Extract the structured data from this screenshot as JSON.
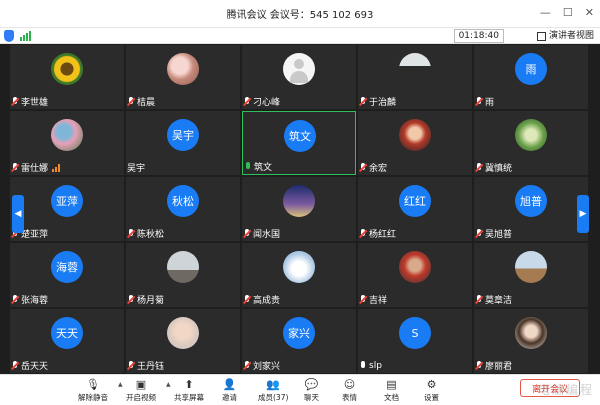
{
  "window": {
    "title": "腾讯会议  会议号：545 102 693",
    "controls": [
      "—",
      "☐",
      "✕"
    ]
  },
  "status": {
    "timer": "01:18:40",
    "speaker_view_label": "演讲者视图"
  },
  "participants": [
    {
      "name": "李世雄",
      "avatar": "photo-sunflower",
      "avatar_text": "",
      "mic": "muted",
      "bars": false,
      "active": false
    },
    {
      "name": "桔晨",
      "avatar": "photo-toy",
      "avatar_text": "",
      "mic": "muted",
      "bars": false,
      "active": false
    },
    {
      "name": "刁心峰",
      "avatar": "photo-default",
      "avatar_text": "",
      "mic": "muted",
      "bars": false,
      "active": false
    },
    {
      "name": "于治麟",
      "avatar": "photo-man",
      "avatar_text": "",
      "mic": "muted",
      "bars": false,
      "active": false
    },
    {
      "name": "雨",
      "avatar": "text",
      "avatar_text": "雨",
      "mic": "muted",
      "bars": false,
      "active": false
    },
    {
      "name": "雷仕娜",
      "avatar": "photo-flowers",
      "avatar_text": "",
      "mic": "muted",
      "bars": true,
      "active": false
    },
    {
      "name": "吴宇",
      "avatar": "text",
      "avatar_text": "吴宇",
      "mic": "none",
      "bars": false,
      "active": false
    },
    {
      "name": "筑文",
      "avatar": "text",
      "avatar_text": "筑文",
      "mic": "green",
      "bars": false,
      "active": true
    },
    {
      "name": "余宏",
      "avatar": "photo-child",
      "avatar_text": "",
      "mic": "muted",
      "bars": false,
      "active": false
    },
    {
      "name": "冀慎统",
      "avatar": "photo-green",
      "avatar_text": "",
      "mic": "muted",
      "bars": false,
      "active": false
    },
    {
      "name": "楚亚萍",
      "avatar": "text",
      "avatar_text": "亚萍",
      "mic": "muted",
      "bars": false,
      "active": false
    },
    {
      "name": "陈秋松",
      "avatar": "text",
      "avatar_text": "秋松",
      "mic": "muted",
      "bars": false,
      "active": false
    },
    {
      "name": "闻水国",
      "avatar": "photo-night",
      "avatar_text": "",
      "mic": "muted",
      "bars": false,
      "active": false
    },
    {
      "name": "杨红红",
      "avatar": "text",
      "avatar_text": "红红",
      "mic": "muted",
      "bars": false,
      "active": false
    },
    {
      "name": "吴旭普",
      "avatar": "text",
      "avatar_text": "旭普",
      "mic": "muted",
      "bars": false,
      "active": false
    },
    {
      "name": "张海蓉",
      "avatar": "text",
      "avatar_text": "海蓉",
      "mic": "muted",
      "bars": false,
      "active": false
    },
    {
      "name": "杨月菊",
      "avatar": "photo-church",
      "avatar_text": "",
      "mic": "muted",
      "bars": false,
      "active": false
    },
    {
      "name": "高成贵",
      "avatar": "photo-cloud",
      "avatar_text": "",
      "mic": "muted",
      "bars": false,
      "active": false
    },
    {
      "name": "吉祥",
      "avatar": "photo-boy",
      "avatar_text": "",
      "mic": "muted",
      "bars": false,
      "active": false
    },
    {
      "name": "莫章洁",
      "avatar": "photo-bridge",
      "avatar_text": "",
      "mic": "muted",
      "bars": false,
      "active": false
    },
    {
      "name": "岳天天",
      "avatar": "text",
      "avatar_text": "天天",
      "mic": "muted",
      "bars": false,
      "active": false
    },
    {
      "name": "王丹钰",
      "avatar": "photo-baby",
      "avatar_text": "",
      "mic": "muted",
      "bars": false,
      "active": false
    },
    {
      "name": "刘家兴",
      "avatar": "text",
      "avatar_text": "家兴",
      "mic": "muted",
      "bars": false,
      "active": false
    },
    {
      "name": "slp",
      "avatar": "text",
      "avatar_text": "S",
      "mic": "plain",
      "bars": false,
      "active": false
    },
    {
      "name": "廖丽君",
      "avatar": "photo-girl",
      "avatar_text": "",
      "mic": "muted",
      "bars": false,
      "active": false
    }
  ],
  "nav": {
    "prev": "◀",
    "next": "▶"
  },
  "toolbar": {
    "items": [
      {
        "label": "解除静音",
        "icon": "microphone-muted-icon",
        "glyph": "🎙"
      },
      {
        "label": "开启视频",
        "icon": "camera-off-icon",
        "glyph": "▣"
      },
      {
        "label": "共享屏幕",
        "icon": "share-screen-icon",
        "glyph": "⬆"
      },
      {
        "label": "邀请",
        "icon": "invite-icon",
        "glyph": "👤"
      },
      {
        "label": "成员(37)",
        "icon": "members-icon",
        "glyph": "👥"
      },
      {
        "label": "聊天",
        "icon": "chat-icon",
        "glyph": "💬"
      },
      {
        "label": "表情",
        "icon": "emoji-icon",
        "glyph": "☺"
      },
      {
        "label": "文档",
        "icon": "document-icon",
        "glyph": "▤"
      },
      {
        "label": "设置",
        "icon": "settings-icon",
        "glyph": "⚙"
      }
    ],
    "leave_label": "离开会议"
  },
  "watermark": "电脑编程"
}
